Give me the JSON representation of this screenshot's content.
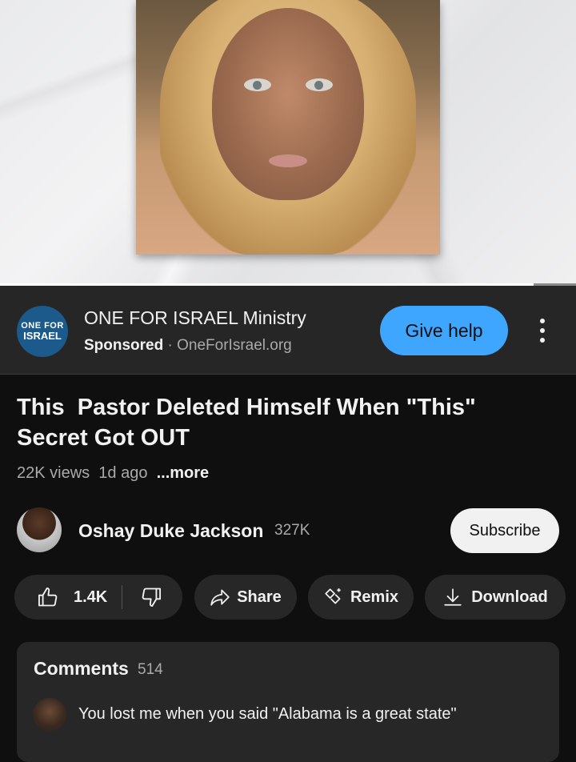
{
  "ad": {
    "advertiser": "ONE FOR ISRAEL Ministry",
    "sponsored_label": "Sponsored",
    "separator": "·",
    "domain": "OneForIsrael.org",
    "logo_line1": "ONE FOR",
    "logo_line2": "ISRAEL",
    "cta_label": "Give help"
  },
  "video": {
    "progress_fraction": 0.926,
    "title": "This  Pastor Deleted Himself When \"This\" Secret Got OUT",
    "views": "22K views",
    "age": "1d ago",
    "more_label": "...more"
  },
  "channel": {
    "name": "Oshay Duke Jackson",
    "subscribers": "327K",
    "subscribe_label": "Subscribe"
  },
  "actions": {
    "likes": "1.4K",
    "share_label": "Share",
    "remix_label": "Remix",
    "download_label": "Download"
  },
  "comments": {
    "header": "Comments",
    "count": "514",
    "top_comment": "You lost me when you said \"Alabama is a great state\""
  },
  "colors": {
    "background": "#0f0f0f",
    "ad_background": "#262626",
    "accent_blue": "#3ea6ff",
    "pill": "#272727"
  }
}
